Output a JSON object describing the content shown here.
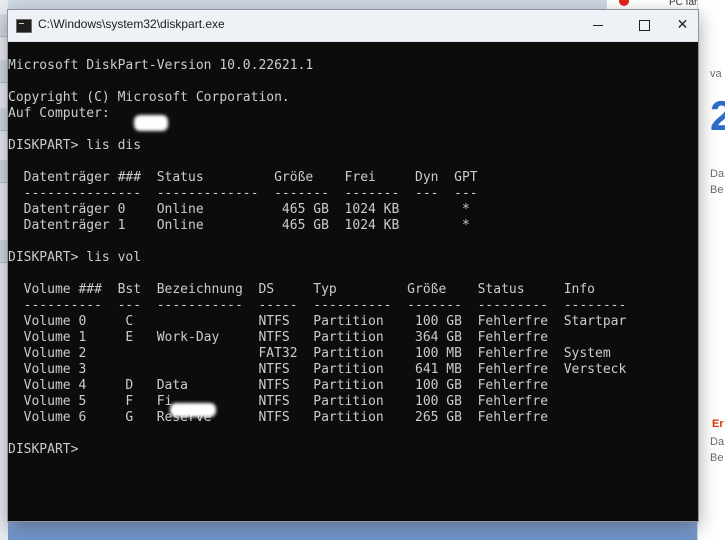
{
  "window": {
    "title": "C:\\Windows\\system32\\diskpart.exe",
    "minimize_label": "",
    "close_label": "✕"
  },
  "console": {
    "lines": [
      "Microsoft DiskPart-Version 10.0.22621.1",
      "",
      "Copyright (C) Microsoft Corporation.",
      "Auf Computer:",
      "",
      "DISKPART> lis dis",
      "",
      "  Datenträger ###  Status         Größe    Frei     Dyn  GPT",
      "  ---------------  -------------  -------  -------  ---  ---",
      "  Datenträger 0    Online          465 GB  1024 KB        *",
      "  Datenträger 1    Online          465 GB  1024 KB        *",
      "",
      "DISKPART> lis vol",
      "",
      "  Volume ###  Bst  Bezeichnung  DS     Typ         Größe    Status     Info",
      "  ----------  ---  -----------  -----  ----------  -------  ---------  --------",
      "  Volume 0     C                NTFS   Partition    100 GB  Fehlerfre  Startpar",
      "  Volume 1     E   Work-Day     NTFS   Partition    364 GB  Fehlerfre",
      "  Volume 2                      FAT32  Partition    100 MB  Fehlerfre  System",
      "  Volume 3                      NTFS   Partition    641 MB  Fehlerfre  Versteck",
      "  Volume 4     D   Data         NTFS   Partition    100 GB  Fehlerfre",
      "  Volume 5     F   Fi           NTFS   Partition    100 GB  Fehlerfre",
      "  Volume 6     G   Reserve      NTFS   Partition    265 GB  Fehlerfre",
      "",
      "DISKPART>"
    ]
  },
  "background": {
    "top_right_text": "PC fährt nic",
    "right_texts": [
      "va",
      "Da",
      "Be",
      "Da",
      "Be"
    ],
    "right_big": "2",
    "right_red": "Er"
  },
  "colors": {
    "console_bg": "#0c0c0c",
    "console_fg": "#cccccc",
    "titlebar_bg": "#eef1f6"
  }
}
